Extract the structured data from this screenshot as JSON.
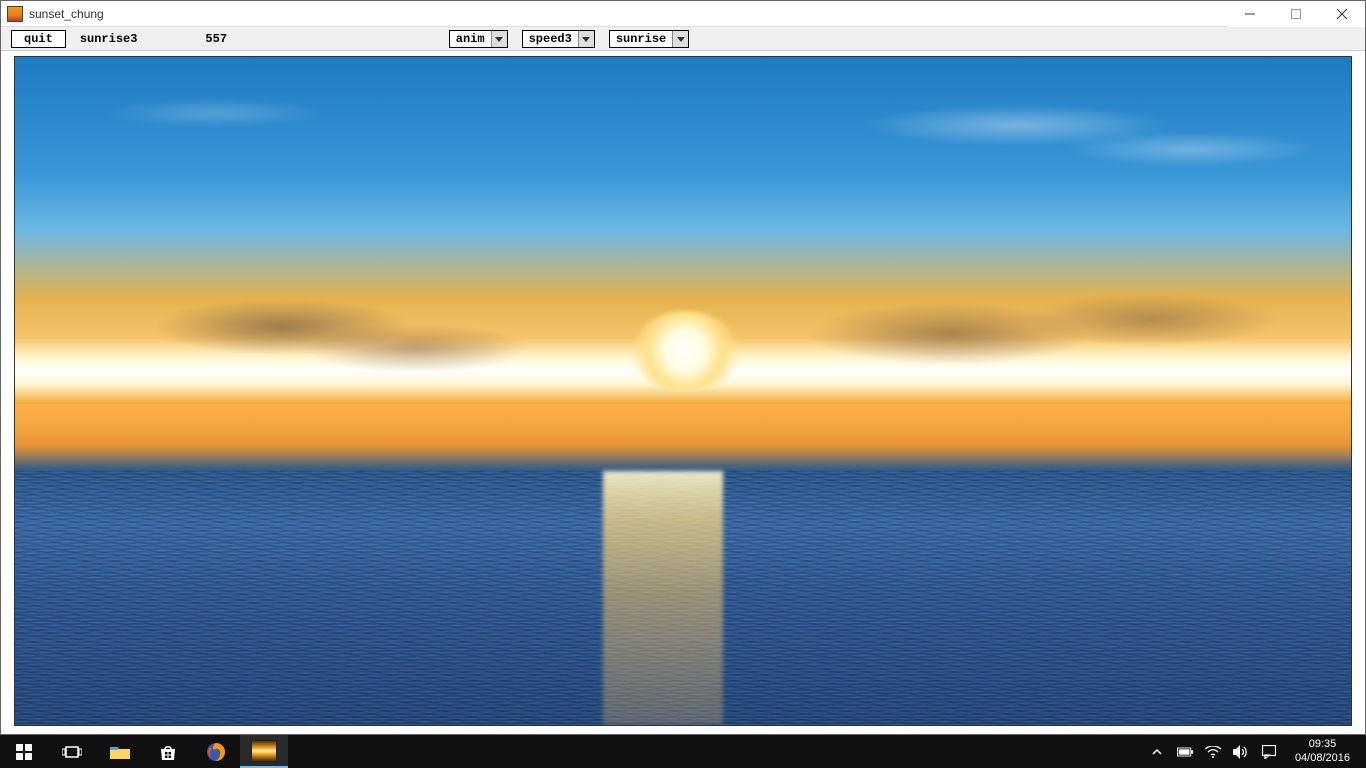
{
  "window": {
    "title": "sunset_chung"
  },
  "toolbar": {
    "quit_label": "quit",
    "mode_label": "sunrise3",
    "counter": "557",
    "dropdowns": {
      "anim": "anim",
      "speed": "speed3",
      "scene": "sunrise"
    }
  },
  "taskbar": {
    "time": "09:35",
    "date": "04/08/2016"
  },
  "icons": {
    "chevron_up": "˄",
    "battery": "▭",
    "wifi": "�言"
  }
}
